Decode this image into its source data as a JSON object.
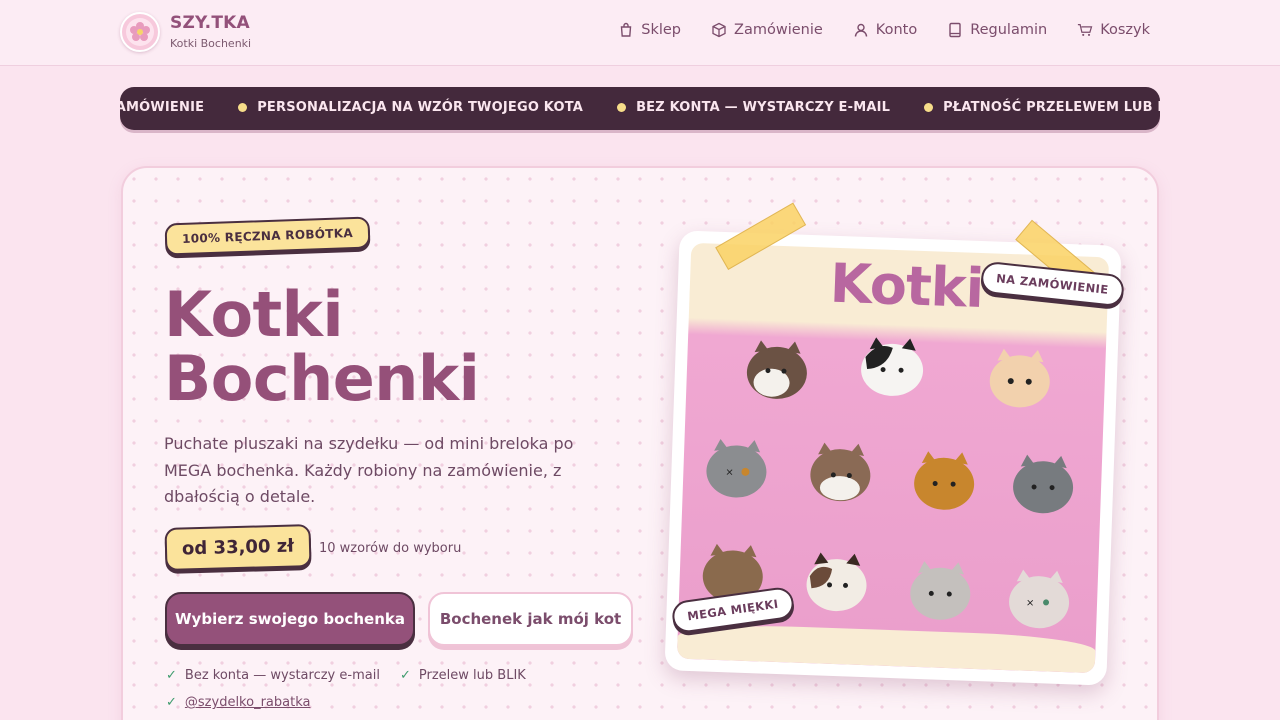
{
  "header": {
    "brand_name": "SZY.TKA",
    "brand_subtitle": "Kotki Bochenki",
    "nav": [
      {
        "label": "Sklep",
        "icon": "shopping-bag-icon"
      },
      {
        "label": "Zamówienie",
        "icon": "box-icon"
      },
      {
        "label": "Konto",
        "icon": "user-icon"
      },
      {
        "label": "Regulamin",
        "icon": "book-icon"
      },
      {
        "label": "Koszyk",
        "icon": "cart-icon"
      }
    ]
  },
  "ticker": {
    "items": [
      "NA ZAMÓWIENIE",
      "PERSONALIZACJA NA WZÓR TWOJEGO KOTA",
      "BEZ KONTA — WYSTARCZY E-MAIL",
      "PŁATNOŚĆ PRZELEWEM LUB BLIK"
    ]
  },
  "hero": {
    "badge": "100% RĘCZNA ROBÓTKA",
    "title_line1": "Kotki",
    "title_line2": "Bochenki",
    "description": "Puchate pluszaki na szydełku — od mini breloka po MEGA bochenka. Każdy robiony na zamówienie, z dbałością o detale.",
    "price": "od 33,00 zł",
    "price_note": "10 wzorów do wyboru",
    "primary_button": "Wybierz swojego bochenka",
    "secondary_button": "Bochenek jak mój kot",
    "perks": [
      "Bez konta — wystarczy e-mail",
      "Przelew lub BLIK"
    ],
    "instagram": "@szydelko_rabatka"
  },
  "photo": {
    "title": "Kotki",
    "sticker_top": "NA ZAMÓWIENIE",
    "sticker_bottom": "MEGA MIĘKKI"
  },
  "colors": {
    "primary": "#94517a",
    "dark": "#44293c",
    "accent_yellow": "#fbe39b",
    "background": "#fbe4ef"
  }
}
